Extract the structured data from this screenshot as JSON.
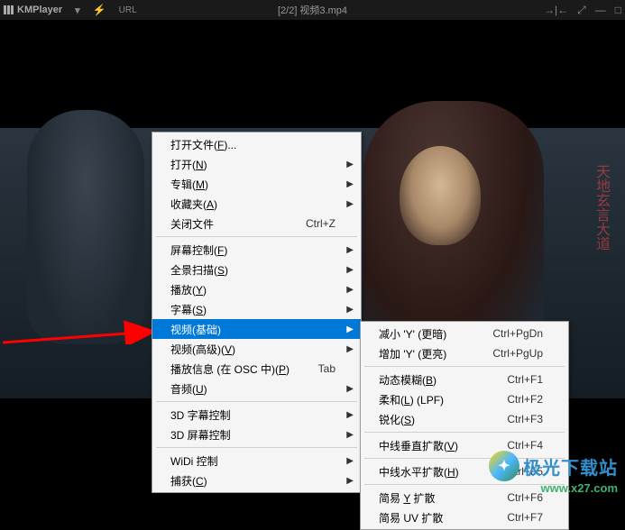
{
  "titlebar": {
    "appName": "KMPlayer",
    "urlLabel": "URL",
    "title": "[2/2] 视频3.mp4"
  },
  "menu": {
    "items": [
      {
        "label": "打开文件(F)...",
        "u": "F",
        "arrow": false
      },
      {
        "label": "打开(N)",
        "u": "N",
        "arrow": true
      },
      {
        "label": "专辑(M)",
        "u": "M",
        "arrow": true
      },
      {
        "label": "收藏夹(A)",
        "u": "A",
        "arrow": true
      },
      {
        "label": "关闭文件",
        "shortcut": "Ctrl+Z",
        "arrow": false
      }
    ],
    "items2": [
      {
        "label": "屏幕控制(F)",
        "u": "F",
        "arrow": true
      },
      {
        "label": "全景扫描(S)",
        "u": "S",
        "arrow": true
      },
      {
        "label": "播放(Y)",
        "u": "Y",
        "arrow": true
      },
      {
        "label": "字幕(S)",
        "u": "S",
        "arrow": true
      },
      {
        "label": "视频(基础)",
        "arrow": true,
        "hl": true
      },
      {
        "label": "视频(高级)(V)",
        "u": "V",
        "arrow": true
      },
      {
        "label": "播放信息 (在 OSC 中)(P)",
        "u": "P",
        "shortcut": "Tab",
        "arrow": false
      },
      {
        "label": "音频(U)",
        "u": "U",
        "arrow": true
      }
    ],
    "items3": [
      {
        "label": "3D 字幕控制",
        "arrow": true
      },
      {
        "label": "3D 屏幕控制",
        "arrow": true
      }
    ],
    "items4": [
      {
        "label": "WiDi 控制",
        "arrow": true
      },
      {
        "label": "捕获(C)",
        "u": "C",
        "arrow": true
      }
    ]
  },
  "submenu": {
    "items": [
      {
        "label": "减小 'Y' (更暗)",
        "shortcut": "Ctrl+PgDn"
      },
      {
        "label": "增加 'Y' (更亮)",
        "shortcut": "Ctrl+PgUp"
      }
    ],
    "items2": [
      {
        "label": "动态模糊(B)",
        "u": "B",
        "shortcut": "Ctrl+F1"
      },
      {
        "label": "柔和(L) (LPF)",
        "u": "L",
        "shortcut": "Ctrl+F2"
      },
      {
        "label": "锐化(S)",
        "u": "S",
        "shortcut": "Ctrl+F3"
      }
    ],
    "items3": [
      {
        "label": "中线垂直扩散(V)",
        "u": "V",
        "shortcut": "Ctrl+F4"
      }
    ],
    "items4": [
      {
        "label": "中线水平扩散(H)",
        "u": "H",
        "shortcut": "Ctrl+F5"
      }
    ],
    "items5": [
      {
        "label": "简易 Y 扩散",
        "u": "Y",
        "shortcut": "Ctrl+F6"
      },
      {
        "label": "简易 UV 扩散",
        "shortcut": "Ctrl+F7"
      }
    ]
  },
  "watermark": {
    "text": "极光下载站",
    "url": "www.x27.com"
  },
  "videoText": "天地玄言大道"
}
